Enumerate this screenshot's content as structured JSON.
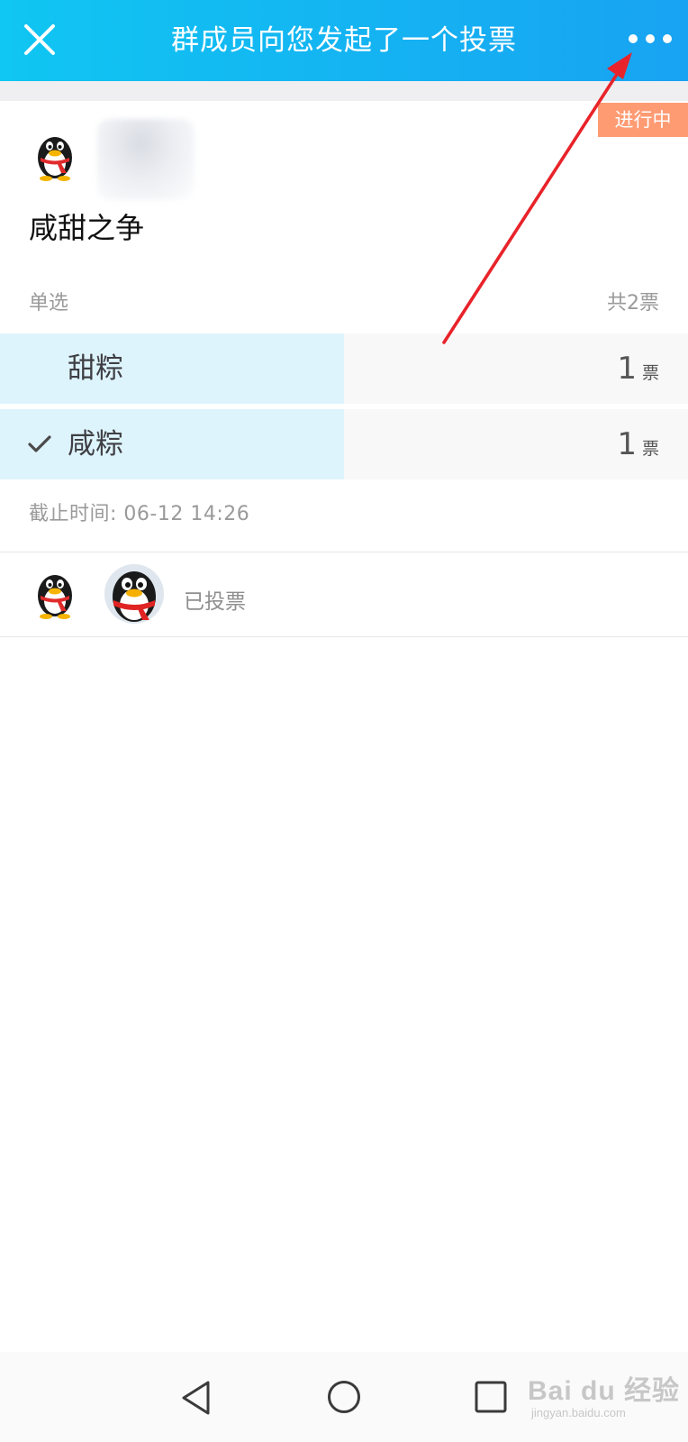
{
  "header": {
    "title": "群成员向您发起了一个投票",
    "close_icon": "close-icon",
    "more_icon": "more-horizontal-icon",
    "background": [
      "#10c6f2",
      "#18a3f2"
    ]
  },
  "poll": {
    "status": "进行中",
    "status_color": "#ff9b73",
    "title": "咸甜之争",
    "type": "单选",
    "total": "共2票",
    "options": [
      {
        "label": "甜粽",
        "count": "1",
        "unit": "票",
        "share": 0.5,
        "selected": false
      },
      {
        "label": "咸粽",
        "count": "1",
        "unit": "票",
        "share": 0.5,
        "selected": true
      }
    ],
    "deadline": "截止时间:  06-12 14:26",
    "voted_label": "已投票"
  },
  "nav": {
    "back_icon": "triangle-back-icon",
    "home_icon": "circle-home-icon",
    "recent_icon": "square-recent-icon"
  },
  "watermark": {
    "main": "Bai du 经验",
    "sub": "jingyan.baidu.com"
  }
}
